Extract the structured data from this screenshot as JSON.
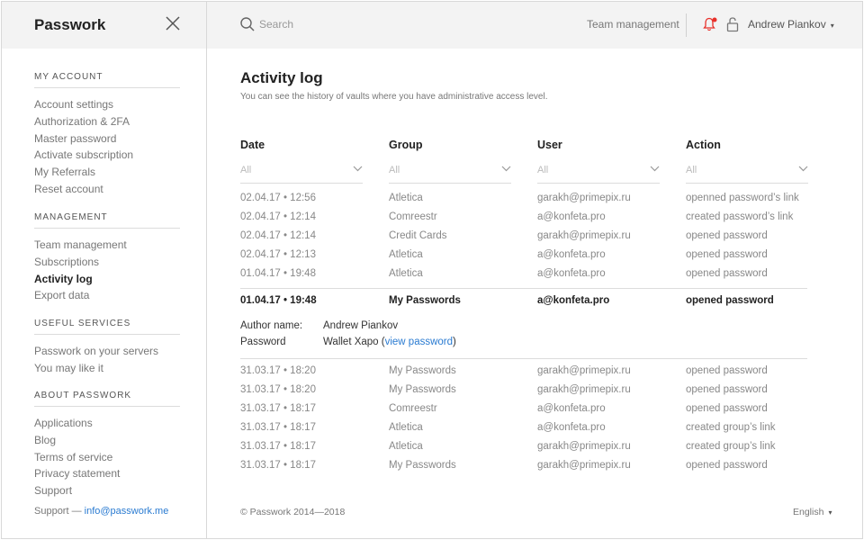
{
  "app": {
    "brand": "Passwork"
  },
  "sidebar": {
    "sections": [
      {
        "heading": "MY ACCOUNT",
        "items": [
          "Account settings",
          "Authorization & 2FA",
          "Master password",
          "Activate subscription",
          "My Referrals",
          "Reset account"
        ]
      },
      {
        "heading": "MANAGEMENT",
        "items": [
          "Team management",
          "Subscriptions",
          "Activity log",
          "Export data"
        ]
      },
      {
        "heading": "USEFUL SERVICES",
        "items": [
          "Passwork on your servers",
          "You may like it"
        ]
      },
      {
        "heading": "ABOUT PASSWORK",
        "items": [
          "Applications",
          "Blog",
          "Terms of service",
          "Privacy statement",
          "Support"
        ]
      }
    ],
    "active_item": "Activity log",
    "support_prefix": "Support — ",
    "support_email": "info@passwork.me"
  },
  "topbar": {
    "search_placeholder": "Search",
    "team_link": "Team management",
    "user_name": "Andrew Piankov",
    "caret": "▾",
    "notification_color": "#e8302a"
  },
  "main": {
    "title": "Activity log",
    "subtitle": "You can see the history of vaults where you have administrative access level.",
    "columns": [
      "Date",
      "Group",
      "User",
      "Action"
    ],
    "filters": [
      "All",
      "All",
      "All",
      "All"
    ],
    "rows_top": [
      [
        "02.04.17 • 12:56",
        "Atletica",
        "garakh@primepix.ru",
        "openned password’s link"
      ],
      [
        "02.04.17 • 12:14",
        "Comreestr",
        "a@konfeta.pro",
        "created password’s link"
      ],
      [
        "02.04.17 • 12:14",
        "Credit Cards",
        "garakh@primepix.ru",
        "opened password"
      ],
      [
        "02.04.17 • 12:13",
        "Atletica",
        "a@konfeta.pro",
        "opened password"
      ],
      [
        "01.04.17 • 19:48",
        "Atletica",
        "a@konfeta.pro",
        "opened password"
      ]
    ],
    "expanded_row": [
      "01.04.17 • 19:48",
      "My Passwords",
      "a@konfeta.pro",
      "opened password"
    ],
    "details": {
      "author_label": "Author name:",
      "author_value": "Andrew Piankov",
      "password_label": "Password",
      "password_value": "Wallet Xapo",
      "link_open": " (",
      "link_text": "view password",
      "link_close": ")"
    },
    "rows_bottom": [
      [
        "31.03.17 • 18:20",
        "My Passwords",
        "garakh@primepix.ru",
        "opened password"
      ],
      [
        "31.03.17 • 18:20",
        "My Passwords",
        "garakh@primepix.ru",
        "opened password"
      ],
      [
        "31.03.17 • 18:17",
        "Comreestr",
        "a@konfeta.pro",
        "opened password"
      ],
      [
        "31.03.17 • 18:17",
        "Atletica",
        "a@konfeta.pro",
        "created group’s link"
      ],
      [
        "31.03.17 • 18:17",
        "Atletica",
        "garakh@primepix.ru",
        "created group’s link"
      ],
      [
        "31.03.17 • 18:17",
        "My Passwords",
        "garakh@primepix.ru",
        "opened password"
      ]
    ]
  },
  "footer": {
    "copyright": "© Passwork 2014—2018",
    "language": "English",
    "caret": "▾"
  }
}
